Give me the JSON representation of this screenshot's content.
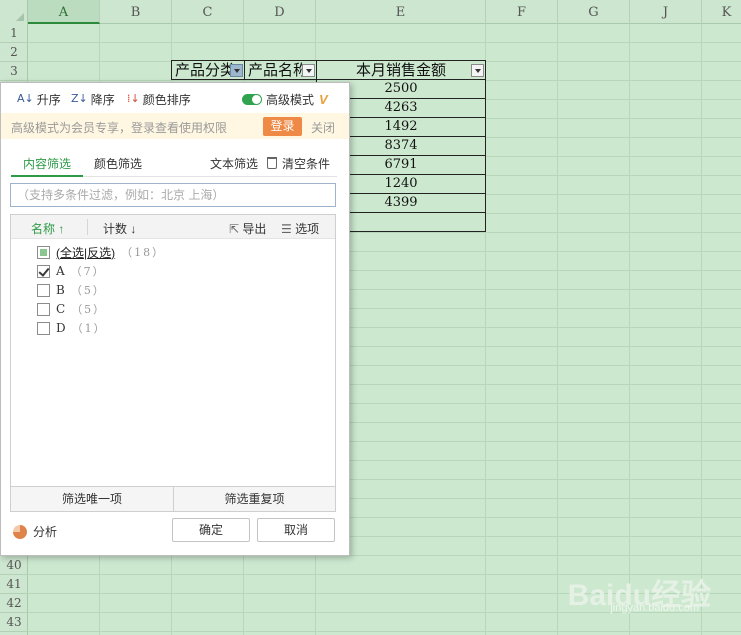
{
  "columns": [
    "A",
    "B",
    "C",
    "D",
    "E",
    "F",
    "G",
    "J",
    "K"
  ],
  "rows_top": [
    "1",
    "2",
    "3"
  ],
  "rows_bottom": [
    "40",
    "41",
    "42",
    "43"
  ],
  "table": {
    "headers": [
      "产品分类",
      "产品名称",
      "本月销售金额"
    ],
    "amounts": [
      "2500",
      "4263",
      "1492",
      "8374",
      "6791",
      "1240",
      "4399",
      ""
    ]
  },
  "panel": {
    "toolbar": {
      "asc": "升序",
      "desc": "降序",
      "color_sort": "颜色排序",
      "advanced": "高级模式",
      "vip": "V"
    },
    "notice": {
      "text": "高级模式为会员专享，登录查看使用权限",
      "login": "登录",
      "close": "关闭"
    },
    "tabs": {
      "content": "内容筛选",
      "color": "颜色筛选",
      "text": "文本筛选",
      "clear": "清空条件"
    },
    "search_placeholder": "（支持多条件过滤，例如：北京  上海）",
    "list_header": {
      "name": "名称",
      "count": "计数",
      "export": "导出",
      "options": "选项"
    },
    "select_all": {
      "all": "全选",
      "invert": "反选",
      "count": "（18）"
    },
    "items": [
      {
        "label": "A",
        "count": "（7）",
        "checked": true
      },
      {
        "label": "B",
        "count": "（5）",
        "checked": false
      },
      {
        "label": "C",
        "count": "（5）",
        "checked": false
      },
      {
        "label": "D",
        "count": "（1）",
        "checked": false
      }
    ],
    "bottom": {
      "unique": "筛选唯一项",
      "duplicate": "筛选重复项"
    },
    "analysis": "分析",
    "ok": "确定",
    "cancel": "取消"
  },
  "watermark": {
    "brand": "Baidu经验",
    "url": "jingyan.baidu.com"
  },
  "colors": {
    "sheet_bg": "#cce8cf",
    "accent_green": "#2e9a46",
    "login_orange": "#ee8a45"
  }
}
